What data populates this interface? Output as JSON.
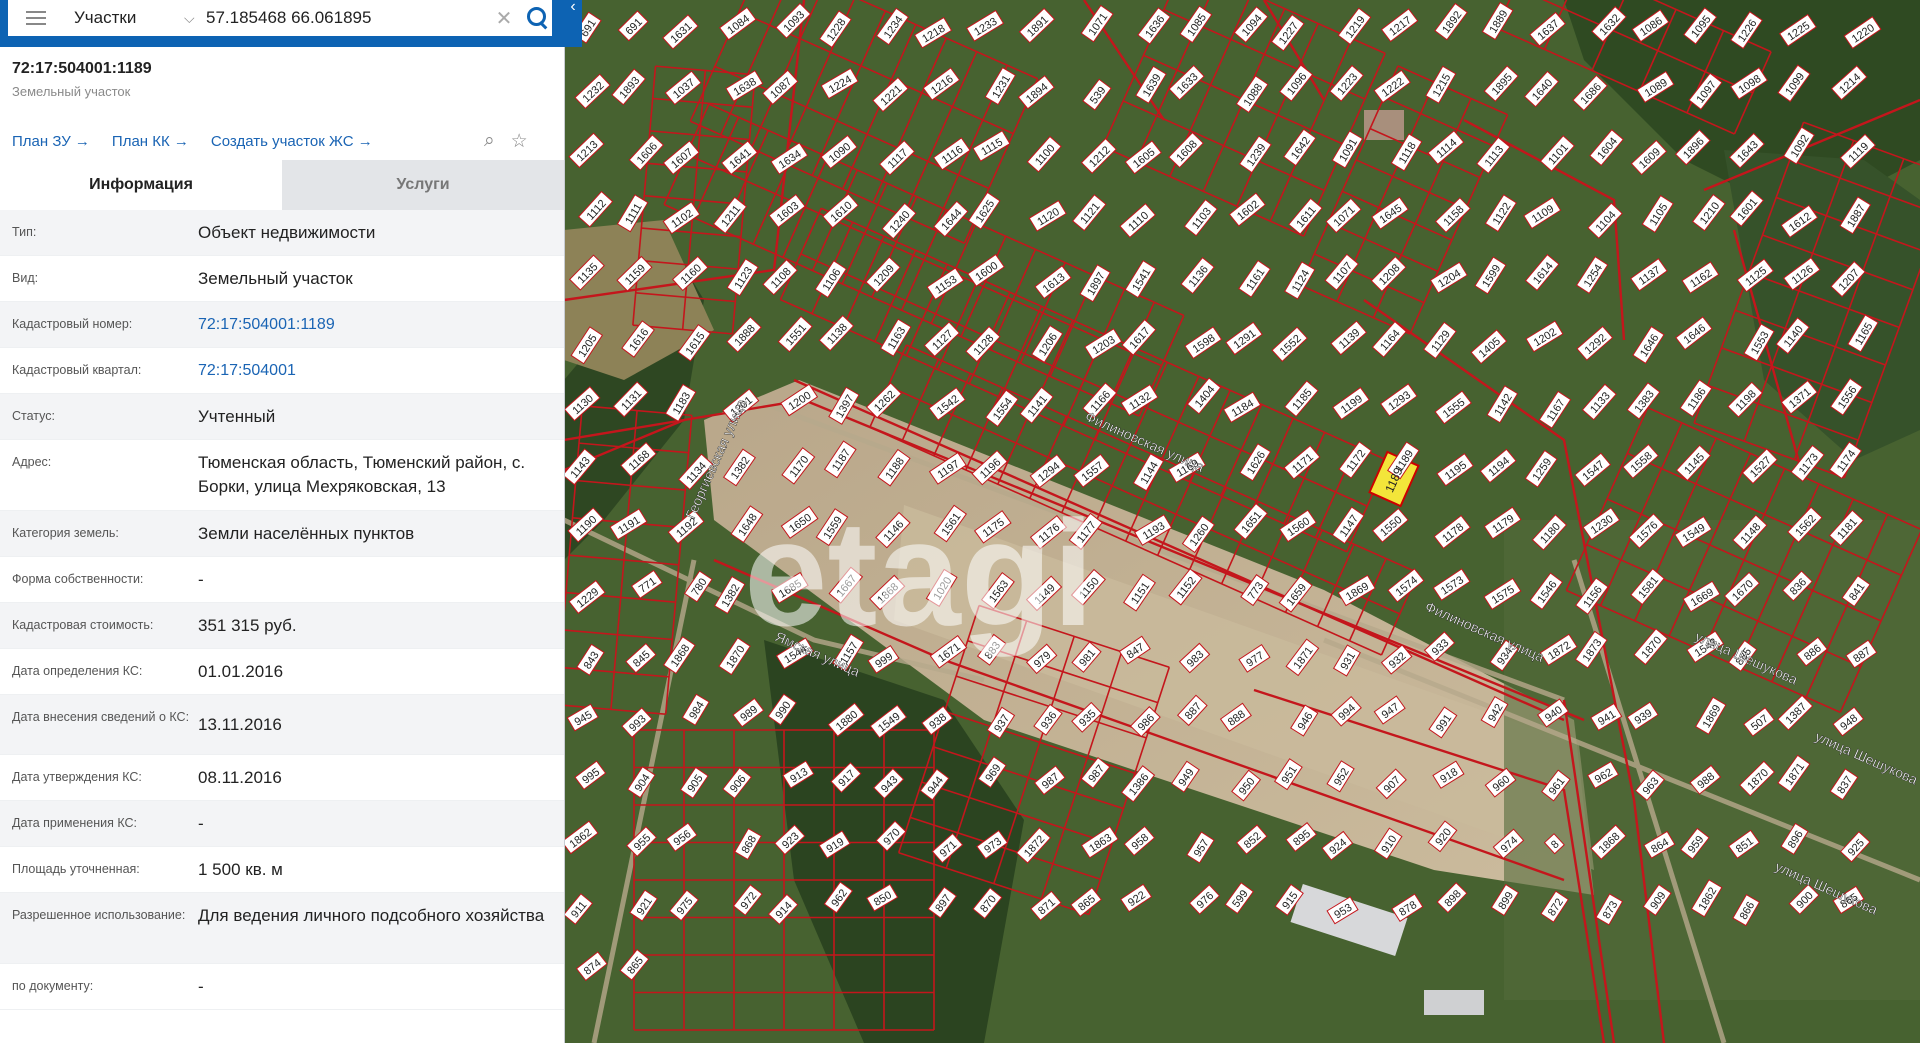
{
  "search": {
    "layer": "Участки",
    "query": "57.185468 66.061895"
  },
  "parcel": {
    "number": "72:17:504001:1189",
    "type_label": "Земельный участок"
  },
  "links": [
    "План ЗУ →",
    "План КК →",
    "Создать участок ЖС →"
  ],
  "tabs": {
    "info": "Информация",
    "services": "Услуги"
  },
  "info_rows": [
    {
      "label": "Тип:",
      "value": "Объект недвижимости"
    },
    {
      "label": "Вид:",
      "value": "Земельный участок"
    },
    {
      "label": "Кадастровый номер:",
      "value": "72:17:504001:1189"
    },
    {
      "label": "Кадастровый квартал:",
      "value": "72:17:504001"
    },
    {
      "label": "Статус:",
      "value": "Учтенный"
    },
    {
      "label": "Адрес:",
      "value": "Тюменская область, Тюменский район, с. Борки, улица Мехряковская, 13"
    },
    {
      "label": "Категория земель:",
      "value": "Земли населённых пунктов"
    },
    {
      "label": "Форма собственности:",
      "value": "-"
    },
    {
      "label": "Кадастровая стоимость:",
      "value": "351 315 руб."
    },
    {
      "label": "Дата определения КС:",
      "value": "01.01.2016"
    },
    {
      "label": "Дата внесения сведений о КС:",
      "value": "13.11.2016"
    },
    {
      "label": "Дата утверждения КС:",
      "value": "08.11.2016"
    },
    {
      "label": "Дата применения КС:",
      "value": "-"
    },
    {
      "label": "Площадь уточненная:",
      "value": "1 500 кв. м"
    },
    {
      "label": "Разрешенное использование:",
      "value": "Для ведения личного подсобного хозяйства"
    },
    {
      "label": "по документу:",
      "value": "-"
    }
  ],
  "map": {
    "watermark": "etagi",
    "selected_parcel": "1189",
    "streets": [
      "Филиновская улица",
      "Филиновская улица",
      "Георгиевская улица",
      "Ямская улица",
      "улица Шешукова",
      "улица Шешукова",
      "улица Шешукова"
    ],
    "parcel_labels": [
      "691",
      "691",
      "1631",
      "1084",
      "1093",
      "1228",
      "1234",
      "1218",
      "1233",
      "1891",
      "1071",
      "1636",
      "1085",
      "1094",
      "1227",
      "1219",
      "1217",
      "1892",
      "1889",
      "1637",
      "1632",
      "1086",
      "1095",
      "1226",
      "1225",
      "1220",
      "1232",
      "1893",
      "1037",
      "1638",
      "1087",
      "1224",
      "1221",
      "1216",
      "1231",
      "1894",
      "539",
      "1639",
      "1633",
      "1088",
      "1096",
      "1223",
      "1222",
      "1215",
      "1895",
      "1640",
      "1686",
      "1089",
      "1097",
      "1098",
      "1099",
      "1214",
      "1213",
      "1606",
      "1607",
      "1641",
      "1634",
      "1090",
      "1117",
      "1116",
      "1115",
      "1100",
      "1212",
      "1605",
      "1608",
      "1239",
      "1642",
      "1091",
      "1118",
      "1114",
      "1113",
      "1101",
      "1604",
      "1609",
      "1896",
      "1643",
      "1092",
      "1119",
      "1112",
      "1111",
      "1102",
      "1211",
      "1603",
      "1610",
      "1240",
      "1644",
      "1625",
      "1120",
      "1121",
      "1110",
      "1103",
      "1602",
      "1611",
      "1071",
      "1645",
      "1158",
      "1122",
      "1109",
      "1104",
      "1105",
      "1210",
      "1601",
      "1612",
      "1887",
      "1135",
      "1159",
      "1160",
      "1123",
      "1108",
      "1106",
      "1209",
      "1153",
      "1600",
      "1613",
      "1897",
      "1541",
      "1136",
      "1161",
      "1124",
      "1107",
      "1208",
      "1204",
      "1599",
      "1614",
      "1254",
      "1137",
      "1162",
      "1125",
      "1126",
      "1207",
      "1205",
      "1616",
      "1615",
      "1888",
      "1551",
      "1138",
      "1163",
      "1127",
      "1128",
      "1206",
      "1203",
      "1617",
      "1598",
      "1291",
      "1552",
      "1139",
      "1164",
      "1129",
      "1405",
      "1202",
      "1292",
      "1646",
      "1646",
      "1553",
      "1140",
      "1165",
      "1130",
      "1131",
      "1183",
      "1201",
      "1200",
      "1397",
      "1262",
      "1542",
      "1554",
      "1141",
      "1166",
      "1132",
      "1404",
      "1184",
      "1185",
      "1199",
      "1293",
      "1555",
      "1142",
      "1167",
      "1133",
      "1383",
      "1186",
      "1198",
      "1371",
      "1556",
      "1143",
      "1168",
      "1134",
      "1382",
      "1170",
      "1187",
      "1188",
      "1197",
      "1196",
      "1294",
      "1557",
      "1144",
      "1169",
      "1626",
      "1171",
      "1172",
      "1189",
      "1195",
      "1194",
      "1259",
      "1547",
      "1558",
      "1145",
      "1527",
      "1173",
      "1174",
      "1190",
      "1191",
      "1192",
      "1648",
      "1650",
      "1559",
      "1146",
      "1561",
      "1175",
      "1176",
      "1177",
      "1193",
      "1260",
      "1651",
      "1560",
      "1147",
      "1550",
      "1178",
      "1179",
      "1180",
      "1230",
      "1576",
      "1549",
      "1148",
      "1562",
      "1181",
      "1229",
      "771",
      "780",
      "1382",
      "1685",
      "1667",
      "1868",
      "1020",
      "1563",
      "1149",
      "1150",
      "1151",
      "1152",
      "773",
      "1659",
      "1869",
      "1574",
      "1573",
      "1575",
      "1546",
      "1156",
      "1581",
      "1669",
      "1670",
      "836",
      "841",
      "843",
      "845",
      "1868",
      "1870",
      "1544",
      "1157",
      "999",
      "1671",
      "883",
      "979",
      "981",
      "847",
      "983",
      "977",
      "1871",
      "931",
      "932",
      "933",
      "934",
      "1872",
      "1873",
      "1870",
      "1543",
      "885",
      "886",
      "887",
      "945",
      "993",
      "984",
      "989",
      "990",
      "1880",
      "1549",
      "938",
      "937",
      "936",
      "935",
      "986",
      "887",
      "888",
      "946",
      "994",
      "947",
      "991",
      "942",
      "940",
      "941",
      "939",
      "1869",
      "507",
      "1387",
      "948",
      "995",
      "904",
      "905",
      "906",
      "913",
      "917",
      "943",
      "944",
      "969",
      "987",
      "987",
      "1386",
      "949",
      "950",
      "951",
      "952",
      "907",
      "918",
      "960",
      "961",
      "962",
      "963",
      "988",
      "1870",
      "1871",
      "837",
      "1862",
      "955",
      "956",
      "868",
      "923",
      "919",
      "970",
      "971",
      "973",
      "1872",
      "1863",
      "958",
      "957",
      "852",
      "895",
      "924",
      "910",
      "920",
      "974",
      "8",
      "1868",
      "864",
      "959",
      "851",
      "896",
      "925",
      "911",
      "921",
      "975",
      "972",
      "914",
      "962",
      "850",
      "897",
      "870",
      "871",
      "865",
      "922",
      "976",
      "599",
      "915",
      "953",
      "878",
      "898",
      "899",
      "872",
      "873",
      "909",
      "1862",
      "866",
      "900",
      "865",
      "874",
      "865"
    ]
  }
}
